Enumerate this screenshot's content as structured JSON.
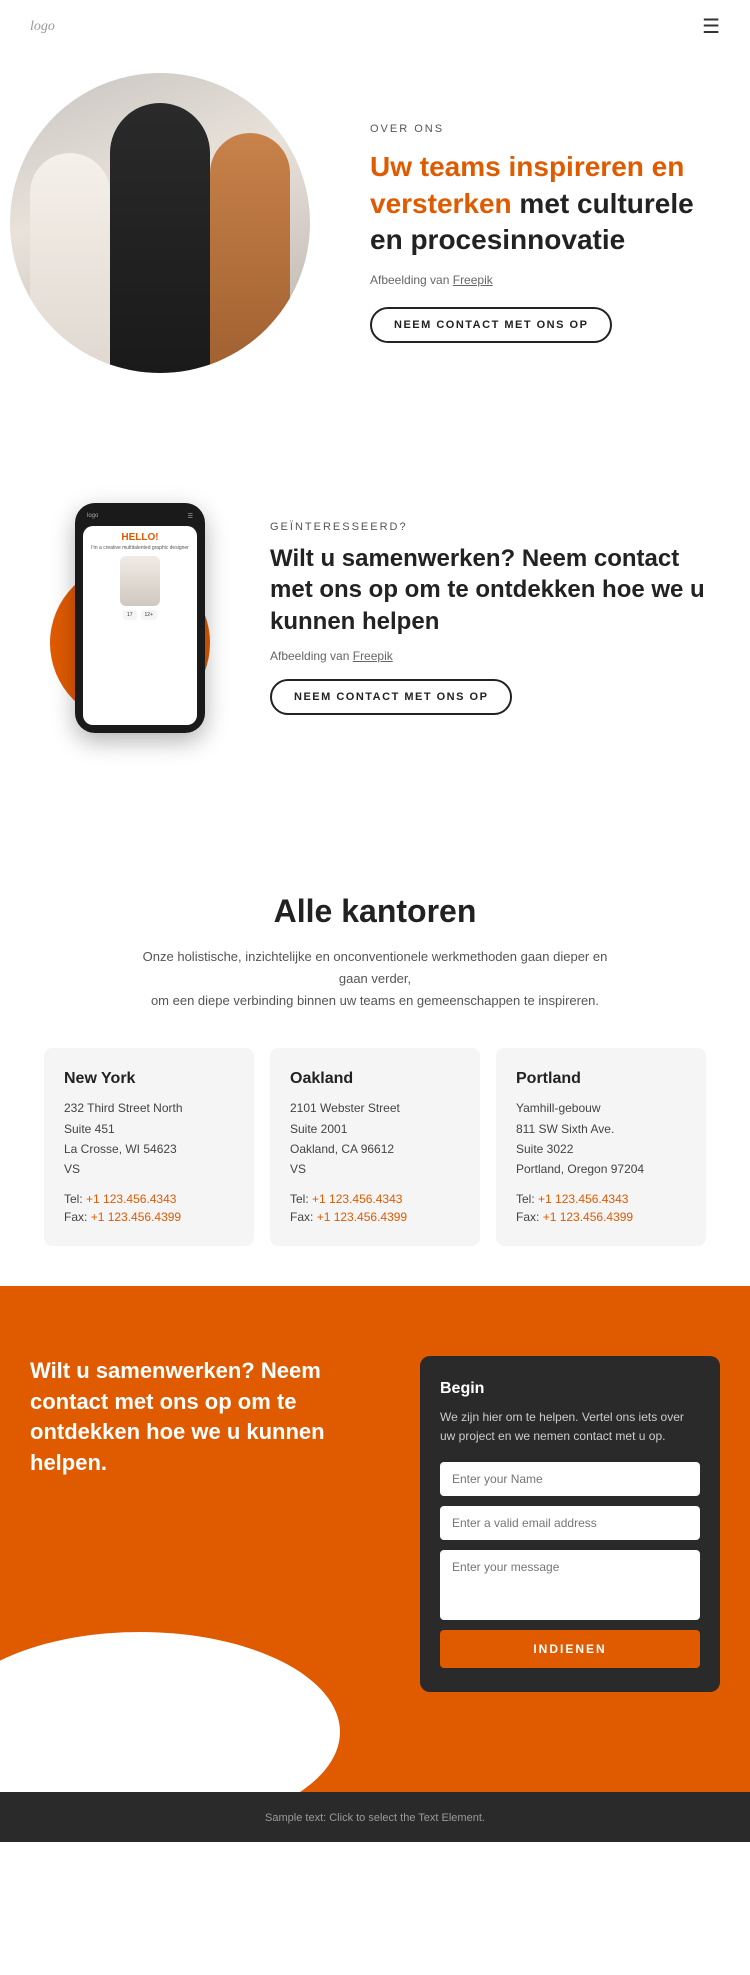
{
  "nav": {
    "logo": "logo",
    "hamburger_icon": "☰"
  },
  "hero": {
    "tag": "OVER ONS",
    "title_orange": "Uw teams inspireren en versterken",
    "title_black": " met culturele en procesinnovatie",
    "credit_prefix": "Afbeelding van ",
    "credit_link": "Freepik",
    "cta_button": "NEEM CONTACT MET ONS OP"
  },
  "section2": {
    "tag": "GEÏNTERESSEERD?",
    "title": "Wilt u samenwerken? Neem contact met ons op om te ontdekken hoe we u kunnen helpen",
    "credit_prefix": "Afbeelding van ",
    "credit_link": "Freepik",
    "cta_button": "NEEM CONTACT MET ONS OP",
    "phone": {
      "logo": "logo",
      "hello": "HELLO!",
      "sub": "I'm a creative multitalented graphic designer",
      "stat1": "17",
      "stat2": "12+"
    }
  },
  "offices": {
    "title": "Alle kantoren",
    "description_line1": "Onze holistische, inzichtelijke en onconventionele werkmethoden gaan dieper en gaan verder,",
    "description_line2": "om een diepe verbinding binnen uw teams en gemeenschappen te inspireren.",
    "cards": [
      {
        "city": "New York",
        "address": "232 Third Street North\nSuite 451\nLa Crosse, WI 54623\nVS",
        "tel_label": "Tel:",
        "tel": "+1 123.456.4343",
        "fax_label": "Fax:",
        "fax": "+1 123.456.4399"
      },
      {
        "city": "Oakland",
        "address": "2101 Webster Street\nSuite 2001\nOakland, CA 96612\nVS",
        "tel_label": "Tel:",
        "tel": "+1 123.456.4343",
        "fax_label": "Fax:",
        "fax": "+1 123.456.4399"
      },
      {
        "city": "Portland",
        "address": "Yamhill-gebouw\n811 SW Sixth Ave.\nSuite 3022\nPortland, Oregon 97204",
        "tel_label": "Tel:",
        "tel": "+1 123.456.4343",
        "fax_label": "Fax:",
        "fax": "+1 123.456.4399"
      }
    ]
  },
  "cta": {
    "title": "Wilt u samenwerken? Neem contact met ons op om te ontdekken hoe we u kunnen helpen.",
    "form": {
      "heading": "Begin",
      "description": "We zijn hier om te helpen. Vertel ons iets over uw project en we nemen contact met u op.",
      "name_placeholder": "Enter your Name",
      "email_placeholder": "Enter a valid email address",
      "message_placeholder": "Enter your message",
      "submit_label": "INDIENEN"
    }
  },
  "footer": {
    "text": "Sample text: Click to select the Text Element."
  },
  "colors": {
    "orange": "#e05a00",
    "dark": "#2a2a2a",
    "light_gray": "#f5f5f5"
  }
}
